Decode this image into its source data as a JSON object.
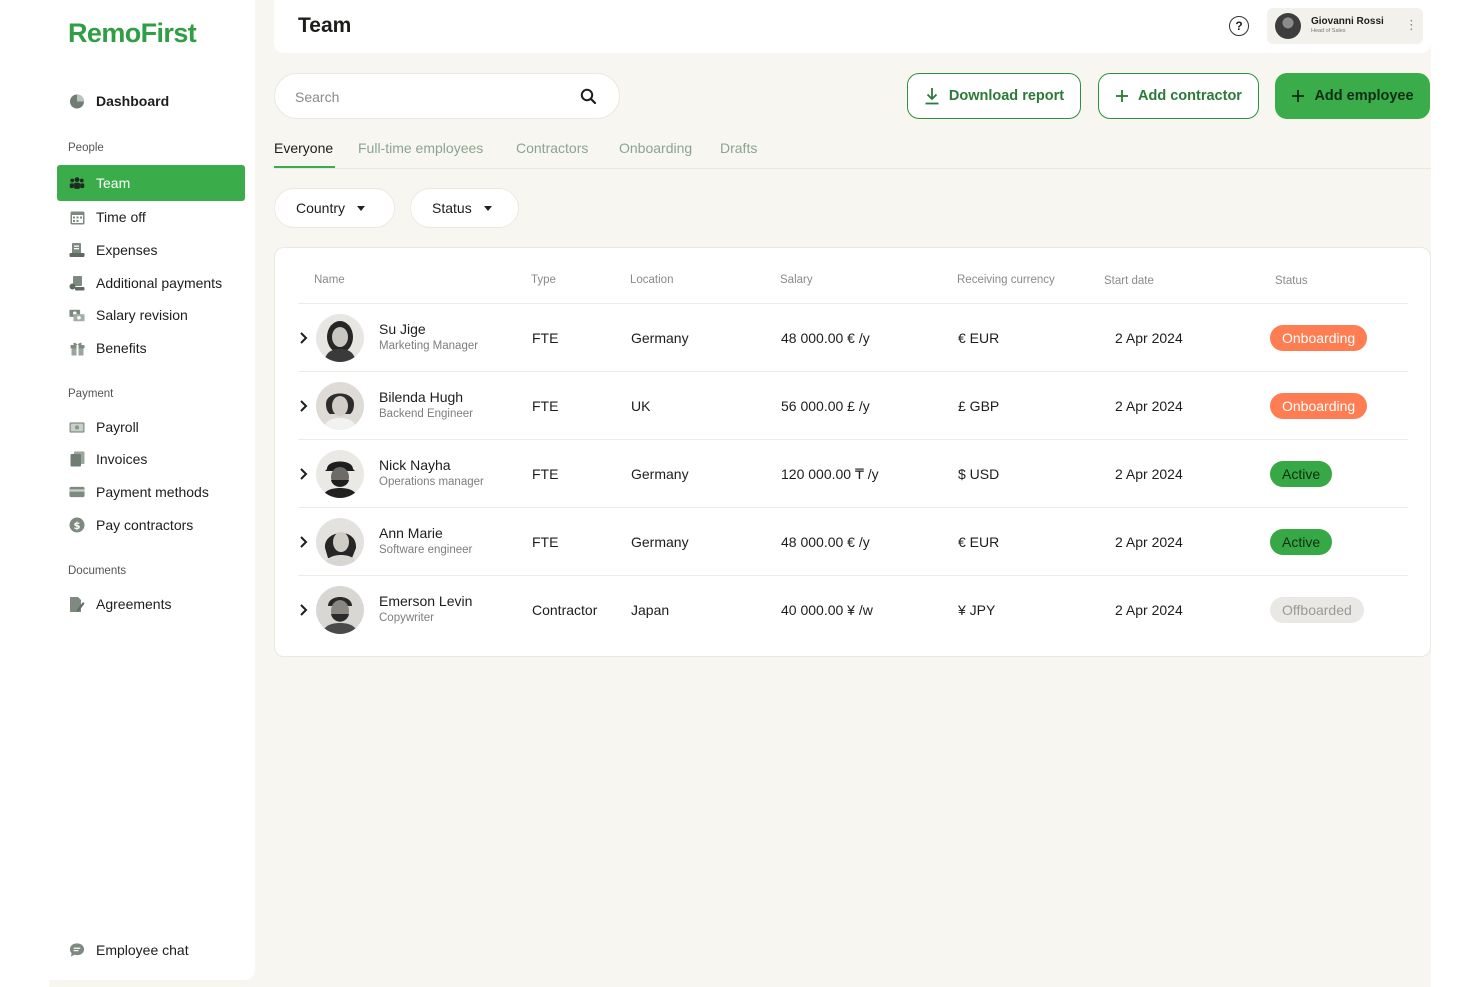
{
  "brand": {
    "name": "RemoFirst",
    "color": "#2f9e44"
  },
  "sidebar": {
    "dashboard": {
      "label": "Dashboard",
      "icon": "pie-chart-icon"
    },
    "sections": [
      {
        "title": "People",
        "items": [
          {
            "label": "Team",
            "icon": "team-icon",
            "active": true
          },
          {
            "label": "Time off",
            "icon": "calendar-icon"
          },
          {
            "label": "Expenses",
            "icon": "receipt-icon"
          },
          {
            "label": "Additional payments",
            "icon": "payments-icon"
          },
          {
            "label": "Salary revision",
            "icon": "salary-icon"
          },
          {
            "label": "Benefits",
            "icon": "gift-icon"
          }
        ]
      },
      {
        "title": "Payment",
        "items": [
          {
            "label": "Payroll",
            "icon": "banknote-icon"
          },
          {
            "label": "Invoices",
            "icon": "invoice-icon"
          },
          {
            "label": "Payment methods",
            "icon": "credit-card-icon"
          },
          {
            "label": "Pay contractors",
            "icon": "dollar-icon"
          }
        ]
      },
      {
        "title": "Documents",
        "items": [
          {
            "label": "Agreements",
            "icon": "document-pen-icon"
          }
        ]
      }
    ],
    "footer": {
      "label": "Employee chat",
      "icon": "chat-icon"
    }
  },
  "header": {
    "title": "Team",
    "help_glyph": "?",
    "user": {
      "name": "Giovanni Rossi",
      "role": "Head of Sales",
      "more_glyph": "⋮"
    }
  },
  "toolbar": {
    "search_placeholder": "Search",
    "download_label": "Download report",
    "add_contractor_label": "Add contractor",
    "add_employee_label": "Add employee"
  },
  "tabs": [
    {
      "label": "Everyone",
      "active": true
    },
    {
      "label": "Full-time employees"
    },
    {
      "label": "Contractors"
    },
    {
      "label": "Onboarding"
    },
    {
      "label": "Drafts"
    }
  ],
  "filters": {
    "country": "Country",
    "status": "Status"
  },
  "table": {
    "columns": {
      "name": "Name",
      "type": "Type",
      "location": "Location",
      "salary": "Salary",
      "currency": "Receiving currency",
      "start": "Start date",
      "status": "Status"
    },
    "rows": [
      {
        "name": "Su Jige",
        "role": "Marketing Manager",
        "type": "FTE",
        "location": "Germany",
        "salary": "48 000.00 € /y",
        "currency": "€ EUR",
        "start": "2 Apr 2024",
        "status": "Onboarding",
        "status_kind": "onboarding"
      },
      {
        "name": "Bilenda Hugh",
        "role": "Backend Engineer",
        "type": "FTE",
        "location": "UK",
        "salary": "56 000.00 £ /y",
        "currency": "£ GBP",
        "start": "2 Apr 2024",
        "status": "Onboarding",
        "status_kind": "onboarding"
      },
      {
        "name": "Nick Nayha",
        "role": "Operations manager",
        "type": "FTE",
        "location": "Germany",
        "salary": "120 000.00 ₸ /y",
        "currency": "$ USD",
        "start": "2 Apr 2024",
        "status": "Active",
        "status_kind": "active"
      },
      {
        "name": "Ann Marie",
        "role": "Software engineer",
        "type": "FTE",
        "location": "Germany",
        "salary": "48 000.00 € /y",
        "currency": "€ EUR",
        "start": "2 Apr 2024",
        "status": "Active",
        "status_kind": "active"
      },
      {
        "name": "Emerson Levin",
        "role": "Copywriter",
        "type": "Contractor",
        "location": "Japan",
        "salary": "40 000.00 ¥ /w",
        "currency": "¥ JPY",
        "start": "2 Apr 2024",
        "status": "Offboarded",
        "status_kind": "offboarded"
      }
    ]
  },
  "colors": {
    "accent": "#3aac4a",
    "onboarding": "#ff7d52",
    "active": "#36a845",
    "offboarded": "#e9e8e5",
    "background": "#f8f6f1"
  }
}
